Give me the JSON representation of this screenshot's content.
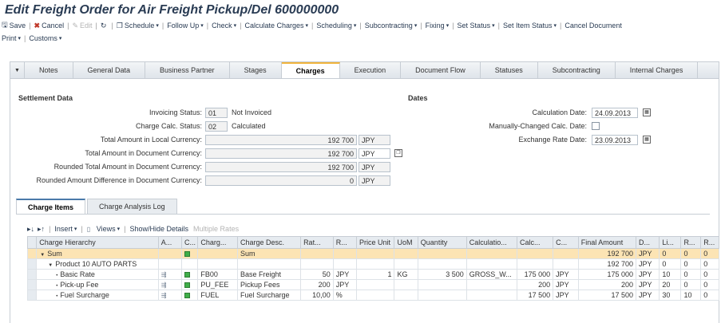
{
  "title": "Edit Freight Order for Air Freight Pickup/Del 600000000",
  "toolbar": {
    "row1": [
      {
        "label": "Save",
        "icon": "save-icon",
        "enabled": true,
        "menu": false
      },
      {
        "label": "Cancel",
        "icon": "cancel-icon",
        "enabled": true,
        "menu": false
      },
      {
        "label": "Edit",
        "icon": "edit-icon",
        "enabled": false,
        "menu": false
      },
      {
        "label": "",
        "icon": "refresh-icon",
        "enabled": true,
        "menu": false
      },
      {
        "label": "Schedule",
        "icon": "copy-icon",
        "enabled": true,
        "menu": true
      },
      {
        "label": "Follow Up",
        "enabled": true,
        "menu": true
      },
      {
        "label": "Check",
        "enabled": true,
        "menu": true
      },
      {
        "label": "Calculate Charges",
        "enabled": true,
        "menu": true
      },
      {
        "label": "Scheduling",
        "enabled": true,
        "menu": true
      },
      {
        "label": "Subcontracting",
        "enabled": true,
        "menu": true
      },
      {
        "label": "Fixing",
        "enabled": true,
        "menu": true
      },
      {
        "label": "Set Status",
        "enabled": true,
        "menu": true
      },
      {
        "label": "Set Item Status",
        "enabled": true,
        "menu": true
      },
      {
        "label": "Cancel Document",
        "enabled": true,
        "menu": false
      }
    ],
    "row2": [
      {
        "label": "Print",
        "enabled": true,
        "menu": true
      },
      {
        "label": "Customs",
        "enabled": true,
        "menu": true
      }
    ]
  },
  "tabs": [
    "Notes",
    "General Data",
    "Business Partner",
    "Stages",
    "Charges",
    "Execution",
    "Document Flow",
    "Statuses",
    "Subcontracting",
    "Internal Charges"
  ],
  "active_tab": "Charges",
  "settlement": {
    "heading": "Settlement Data",
    "invoicing_status_label": "Invoicing Status:",
    "invoicing_status_code": "01",
    "invoicing_status_text": "Not Invoiced",
    "charge_calc_status_label": "Charge Calc. Status:",
    "charge_calc_status_code": "02",
    "charge_calc_status_text": "Calculated",
    "total_local_label": "Total Amount in Local Currency:",
    "total_local_amount": "192 700",
    "total_local_currency": "JPY",
    "total_doc_label": "Total Amount in Document Currency:",
    "total_doc_amount": "192 700",
    "total_doc_currency": "JPY",
    "rounded_total_label": "Rounded Total Amount in Document Currency:",
    "rounded_total_amount": "192 700",
    "rounded_total_currency": "JPY",
    "rounded_diff_label": "Rounded Amount Difference in Document Currency:",
    "rounded_diff_amount": "0",
    "rounded_diff_currency": "JPY"
  },
  "dates": {
    "heading": "Dates",
    "calc_date_label": "Calculation Date:",
    "calc_date": "24.09.2013",
    "manual_calc_label": "Manually-Changed Calc. Date:",
    "exchange_date_label": "Exchange Rate Date:",
    "exchange_date": "23.09.2013"
  },
  "subtabs": [
    "Charge Items",
    "Charge Analysis Log"
  ],
  "active_subtab": "Charge Items",
  "grid_toolbar": {
    "insert": "Insert",
    "views": "Views",
    "show_hide": "Show/Hide Details",
    "multiple_rates": "Multiple Rates"
  },
  "grid": {
    "columns": [
      "Charge Hierarchy",
      "A...",
      "C...",
      "Charg...",
      "Charge Desc.",
      "Rat...",
      "R...",
      "Price Unit",
      "UoM",
      "Quantity",
      "Calculatio...",
      "Calc...",
      "C...",
      "Final Amount",
      "D...",
      "Li...",
      "R...",
      "R..."
    ],
    "rows": [
      {
        "type": "sum",
        "hierarchy": "Sum",
        "level": 0,
        "expanded": true,
        "a": "",
        "status": true,
        "code": "",
        "desc": "Sum",
        "rate": "",
        "rate_unit": "",
        "price_unit": "",
        "uom": "",
        "quantity": "",
        "calc_base": "",
        "calc_amount": "",
        "calc_cur": "",
        "final_amount": "192 700",
        "doc_cur": "JPY",
        "line": "0",
        "r1": "0",
        "r2": "0"
      },
      {
        "type": "group",
        "hierarchy": "Product 10 AUTO PARTS",
        "level": 1,
        "expanded": true,
        "a": "",
        "status": false,
        "code": "",
        "desc": "",
        "rate": "",
        "rate_unit": "",
        "price_unit": "",
        "uom": "",
        "quantity": "",
        "calc_base": "",
        "calc_amount": "",
        "calc_cur": "",
        "final_amount": "192 700",
        "doc_cur": "JPY",
        "line": "0",
        "r1": "0",
        "r2": "0"
      },
      {
        "type": "item",
        "hierarchy": "Basic Rate",
        "level": 2,
        "a": "doc",
        "status": true,
        "code": "FB00",
        "desc": "Base Freight",
        "rate": "50",
        "rate_unit": "JPY",
        "price_unit": "1",
        "uom": "KG",
        "quantity": "3 500",
        "calc_base": "GROSS_W...",
        "calc_amount": "175 000",
        "calc_cur": "JPY",
        "final_amount": "175 000",
        "doc_cur": "JPY",
        "line": "10",
        "r1": "0",
        "r2": "0"
      },
      {
        "type": "item",
        "hierarchy": "Pick-up Fee",
        "level": 2,
        "a": "doc",
        "status": true,
        "code": "PU_FEE",
        "desc": "Pickup Fees",
        "rate": "200",
        "rate_unit": "JPY",
        "price_unit": "",
        "uom": "",
        "quantity": "",
        "calc_base": "",
        "calc_amount": "200",
        "calc_cur": "JPY",
        "final_amount": "200",
        "doc_cur": "JPY",
        "line": "20",
        "r1": "0",
        "r2": "0"
      },
      {
        "type": "item",
        "hierarchy": "Fuel Surcharge",
        "level": 2,
        "a": "doc",
        "status": true,
        "code": "FUEL",
        "desc": "Fuel Surcharge",
        "rate": "10,00",
        "rate_unit": "%",
        "price_unit": "",
        "uom": "",
        "quantity": "",
        "calc_base": "",
        "calc_amount": "17 500",
        "calc_cur": "JPY",
        "final_amount": "17 500",
        "doc_cur": "JPY",
        "line": "30",
        "r1": "10",
        "r2": "0"
      }
    ]
  },
  "colors": {
    "title": "#2a3c54",
    "active_tab_accent": "#f0b43c",
    "sum_row": "#fce4b4",
    "status_green": "#3fae49"
  }
}
